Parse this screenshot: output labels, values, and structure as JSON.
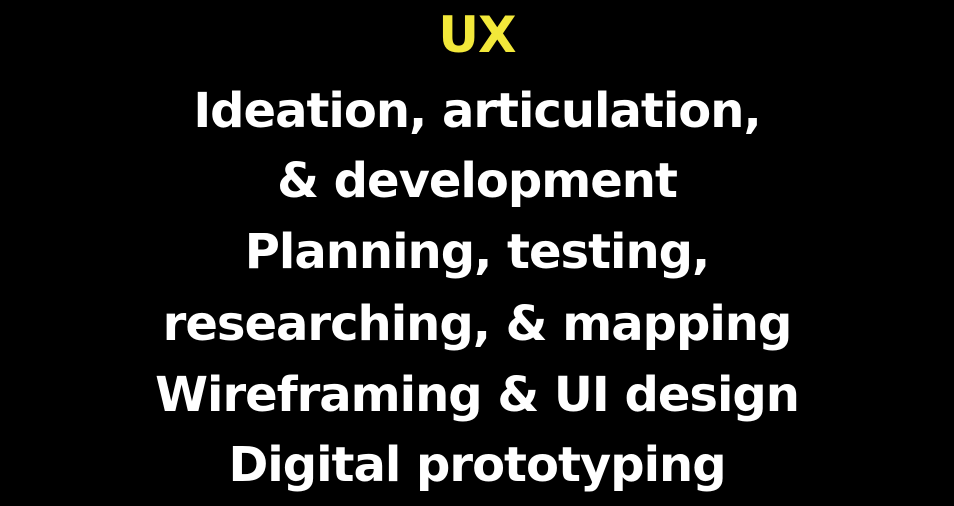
{
  "heading": "UX",
  "lines": [
    "Ideation, articulation,",
    "& development",
    "Planning, testing,",
    "researching, & mapping",
    "Wireframing & UI design",
    "Digital prototyping"
  ],
  "colors": {
    "background": "#000000",
    "heading": "#f2e83a",
    "text": "#ffffff"
  }
}
